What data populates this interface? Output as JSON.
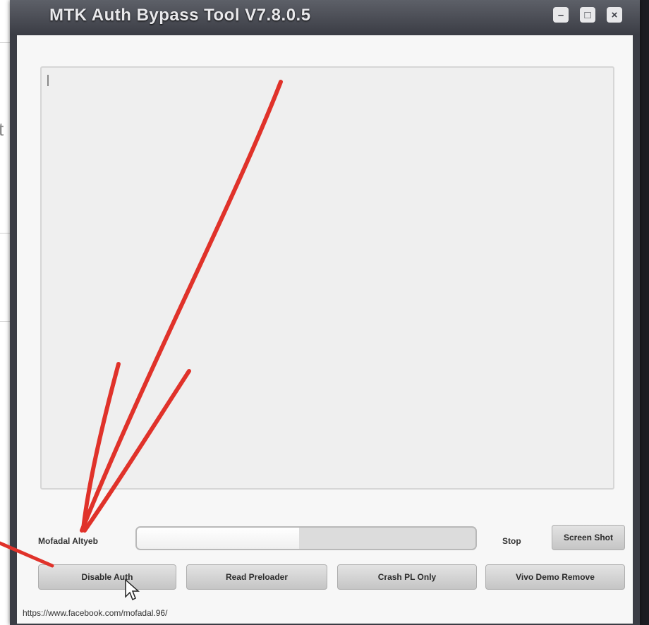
{
  "background_window": {
    "partial_text": "t here"
  },
  "window": {
    "title": "MTK Auth Bypass Tool V7.8.0.5",
    "controls": {
      "minimize": "minimize-icon",
      "maximize": "maximize-icon",
      "close": "close-icon"
    }
  },
  "log": {
    "content": ""
  },
  "status_row": {
    "name_label": "Mofadal Altyeb",
    "progress_percent": 48,
    "stop_label": "Stop",
    "screenshot_button": "Screen Shot"
  },
  "actions": {
    "disable_auth": "Disable Auth",
    "read_preloader": "Read Preloader",
    "crash_pl_only": "Crash PL Only",
    "vivo_demo_remove": "Vivo Demo Remove"
  },
  "footer": {
    "link": "https://www.facebook.com/mofadal.96/"
  },
  "annotation": {
    "arrow_color": "#e0322a"
  }
}
